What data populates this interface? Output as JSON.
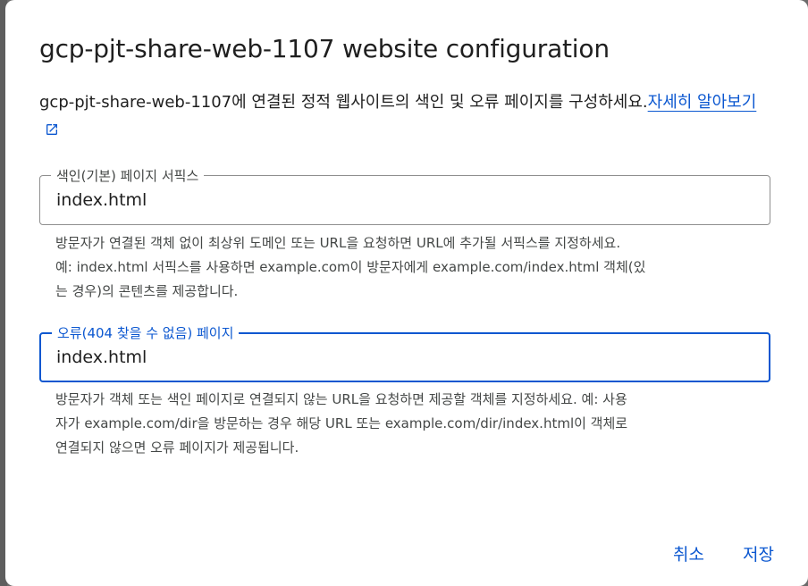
{
  "dialog": {
    "title": "gcp-pjt-share-web-1107 website configuration",
    "description": "gcp-pjt-share-web-1107에 연결된 정적 웹사이트의 색인 및 오류 페이지를 구성하세요.",
    "learn_more_label": "자세히 알아보기",
    "external_link_icon": "external-link-icon",
    "accent_color": "#0b57d0"
  },
  "index_field": {
    "label": "색인(기본) 페이지 서픽스",
    "value": "index.html",
    "helper_lines": [
      "방문자가 연결된 객체 없이 최상위 도메인 또는 URL을 요청하면 URL에 추가될 서픽스를 지정하세요.",
      "예: index.html 서픽스를 사용하면 example.com이 방문자에게 example.com/index.html 객체(있",
      "는 경우)의 콘텐츠를 제공합니다."
    ]
  },
  "error_field": {
    "label": "오류(404 찾을 수 없음) 페이지",
    "value": "index.html",
    "helper_lines": [
      "방문자가 객체 또는 색인 페이지로 연결되지 않는 URL을 요청하면 제공할 객체를 지정하세요. 예: 사용",
      "자가 example.com/dir을 방문하는 경우 해당 URL 또는 example.com/dir/index.html이 객체로",
      "연결되지 않으면 오류 페이지가 제공됩니다."
    ]
  },
  "actions": {
    "cancel_label": "취소",
    "save_label": "저장"
  }
}
